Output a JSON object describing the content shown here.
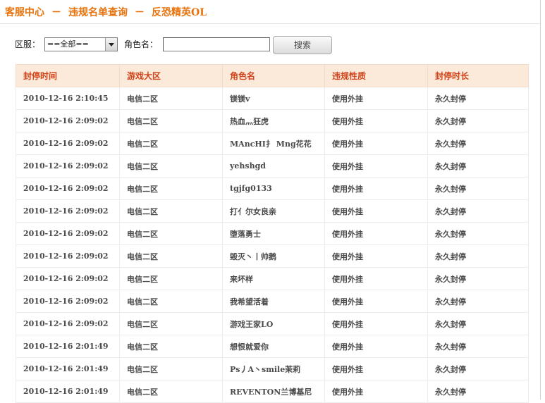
{
  "breadcrumb": {
    "home": "客服中心",
    "separator": "－",
    "page": "违规名单查询",
    "game": "反恐精英OL"
  },
  "search": {
    "server_label": "区服：",
    "server_value": "==全部==",
    "role_label": "角色名：",
    "role_value": "",
    "button_label": "搜索"
  },
  "table": {
    "headers": [
      "封停时间",
      "游戏大区",
      "角色名",
      "违规性质",
      "封停时长"
    ],
    "rows": [
      [
        "2010-12-16 2:10:45",
        "电信二区",
        "镁镁v",
        "使用外挂",
        "永久封停"
      ],
      [
        "2010-12-16 2:09:02",
        "电信二区",
        "热血灬狂虎",
        "使用外挂",
        "永久封停"
      ],
      [
        "2010-12-16 2:09:02",
        "电信二区",
        "MAncHI扌 Mng花花",
        "使用外挂",
        "永久封停"
      ],
      [
        "2010-12-16 2:09:02",
        "电信二区",
        "yehshgd",
        "使用外挂",
        "永久封停"
      ],
      [
        "2010-12-16 2:09:02",
        "电信二区",
        "tgjfg0133",
        "使用外挂",
        "永久封停"
      ],
      [
        "2010-12-16 2:09:02",
        "电信二区",
        "打亻尔女良亲",
        "使用外挂",
        "永久封停"
      ],
      [
        "2010-12-16 2:09:02",
        "电信二区",
        "堕落勇士",
        "使用外挂",
        "永久封停"
      ],
      [
        "2010-12-16 2:09:02",
        "电信二区",
        "毁灭丶丨帅鹅",
        "使用外挂",
        "永久封停"
      ],
      [
        "2010-12-16 2:09:02",
        "电信二区",
        "来坏样",
        "使用外挂",
        "永久封停"
      ],
      [
        "2010-12-16 2:09:02",
        "电信二区",
        "我希望活着",
        "使用外挂",
        "永久封停"
      ],
      [
        "2010-12-16 2:09:02",
        "电信二区",
        "游戏王家LO",
        "使用外挂",
        "永久封停"
      ],
      [
        "2010-12-16 2:01:49",
        "电信二区",
        "想恨就爱你",
        "使用外挂",
        "永久封停"
      ],
      [
        "2010-12-16 2:01:49",
        "电信二区",
        "Ps丿A丶smile茉莉",
        "使用外挂",
        "永久封停"
      ],
      [
        "2010-12-16 2:01:49",
        "电信二区",
        "REVENTON兰博基尼",
        "使用外挂",
        "永久封停"
      ]
    ]
  },
  "colors": {
    "accent": "#e8720c",
    "header_bg": "#fbe9d9",
    "header_text": "#d0431a"
  }
}
